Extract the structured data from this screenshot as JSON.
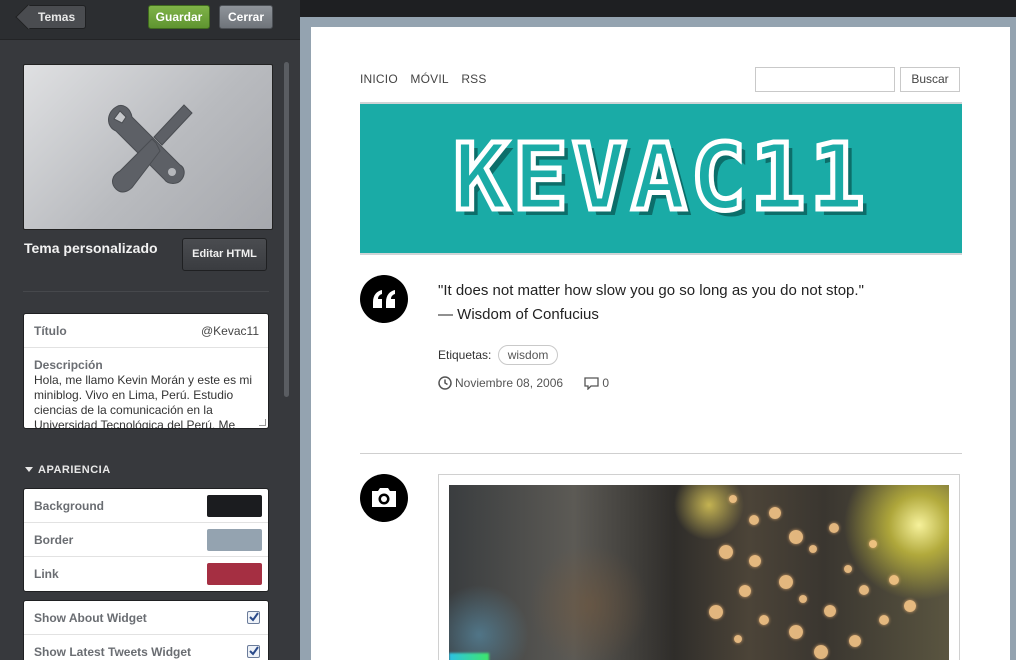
{
  "editor": {
    "back_label": "Temas",
    "save_label": "Guardar",
    "close_label": "Cerrar",
    "theme_name": "Tema personalizado",
    "edit_html_label": "Editar HTML",
    "title_label": "Título",
    "title_value": "@Kevac11",
    "description_label": "Descripción",
    "description_value": "Hola, me llamo Kevin Morán y este es mi miniblog. Vivo en Lima, Perú. Estudio ciencias de la comunicación en la Universidad Tecnológica del Perú. Me",
    "appearance_heading": "APARIENCIA",
    "colors": [
      {
        "label": "Background",
        "color": "#1b1c1f"
      },
      {
        "label": "Border",
        "color": "#94a3b0"
      },
      {
        "label": "Link",
        "color": "#a52f42"
      }
    ],
    "options": [
      {
        "label": "Show About Widget",
        "checked": true
      },
      {
        "label": "Show Latest Tweets Widget",
        "checked": true
      }
    ]
  },
  "preview": {
    "nav": [
      "INICIO",
      "MÓVIL",
      "RSS"
    ],
    "search_button": "Buscar",
    "search_value": "",
    "banner_title": "KEVAC11",
    "quote_text": "\"It does not matter how slow you go so long as you do not stop.\"",
    "quote_source": "— Wisdom of Confucius",
    "tags_label": "Etiquetas:",
    "tag": "wisdom",
    "date": "Noviembre 08, 2006",
    "comments": "0",
    "accent_teal": "#1aaba6"
  }
}
